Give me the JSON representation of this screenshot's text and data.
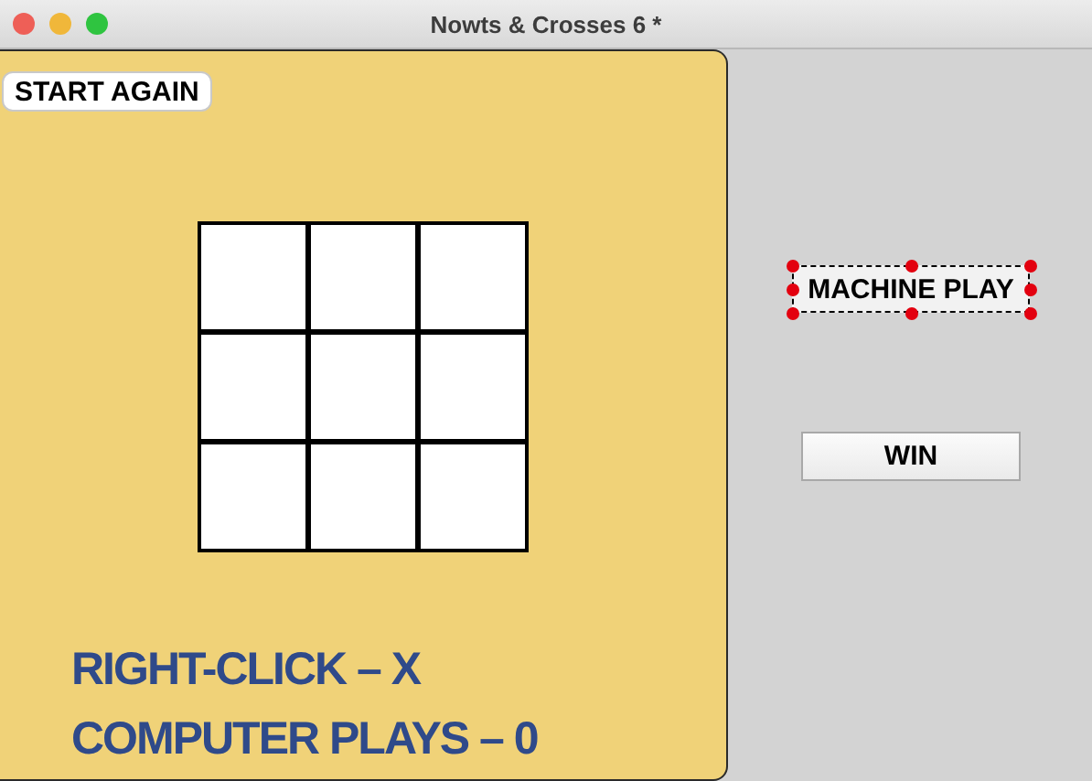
{
  "window": {
    "title": "Nowts & Crosses 6 *"
  },
  "board_panel": {
    "start_button": "START AGAIN",
    "instructions": [
      "RIGHT-CLICK – X",
      "COMPUTER PLAYS – 0"
    ]
  },
  "side_panel": {
    "buttons": [
      {
        "label": "MACHINE PLAY",
        "selected": true
      },
      {
        "label": "WIN",
        "selected": false
      }
    ]
  }
}
